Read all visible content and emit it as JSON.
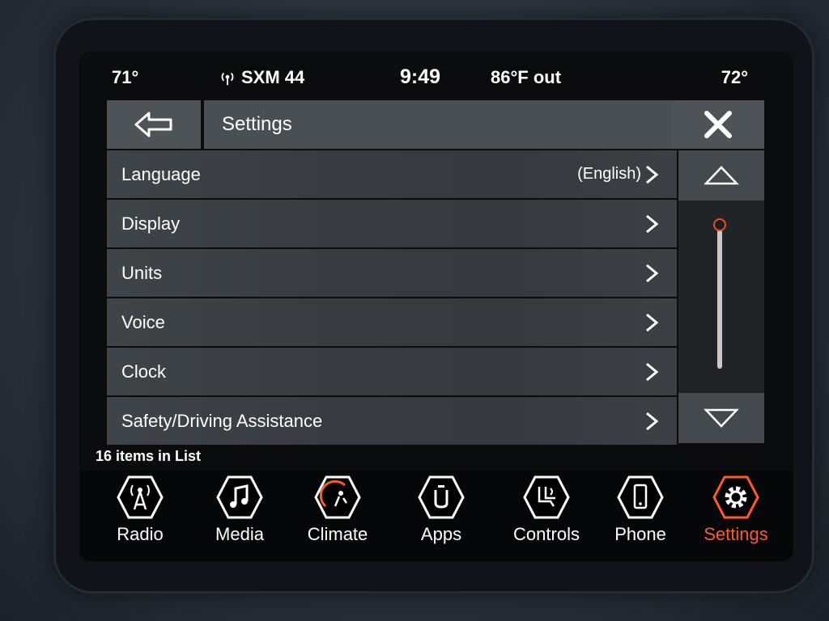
{
  "status": {
    "temp_left": "71°",
    "radio_station": "SXM 44",
    "time": "9:49",
    "outside_temp": "86°F out",
    "temp_right": "72°"
  },
  "header": {
    "title": "Settings"
  },
  "settings_list": {
    "items": [
      {
        "label": "Language",
        "value": "(English)"
      },
      {
        "label": "Display",
        "value": ""
      },
      {
        "label": "Units",
        "value": ""
      },
      {
        "label": "Voice",
        "value": ""
      },
      {
        "label": "Clock",
        "value": ""
      },
      {
        "label": "Safety/Driving Assistance",
        "value": ""
      }
    ],
    "count_text": "16 items in List"
  },
  "nav": [
    {
      "label": "Radio",
      "icon": "radio-tower-icon"
    },
    {
      "label": "Media",
      "icon": "music-note-icon"
    },
    {
      "label": "Climate",
      "icon": "climate-icon"
    },
    {
      "label": "Apps",
      "icon": "apps-icon"
    },
    {
      "label": "Controls",
      "icon": "controls-icon"
    },
    {
      "label": "Phone",
      "icon": "phone-icon"
    },
    {
      "label": "Settings",
      "icon": "gear-icon"
    }
  ],
  "colors": {
    "accent": "#ff5a26",
    "panel": "#4e5357",
    "row": "#3c4044"
  }
}
